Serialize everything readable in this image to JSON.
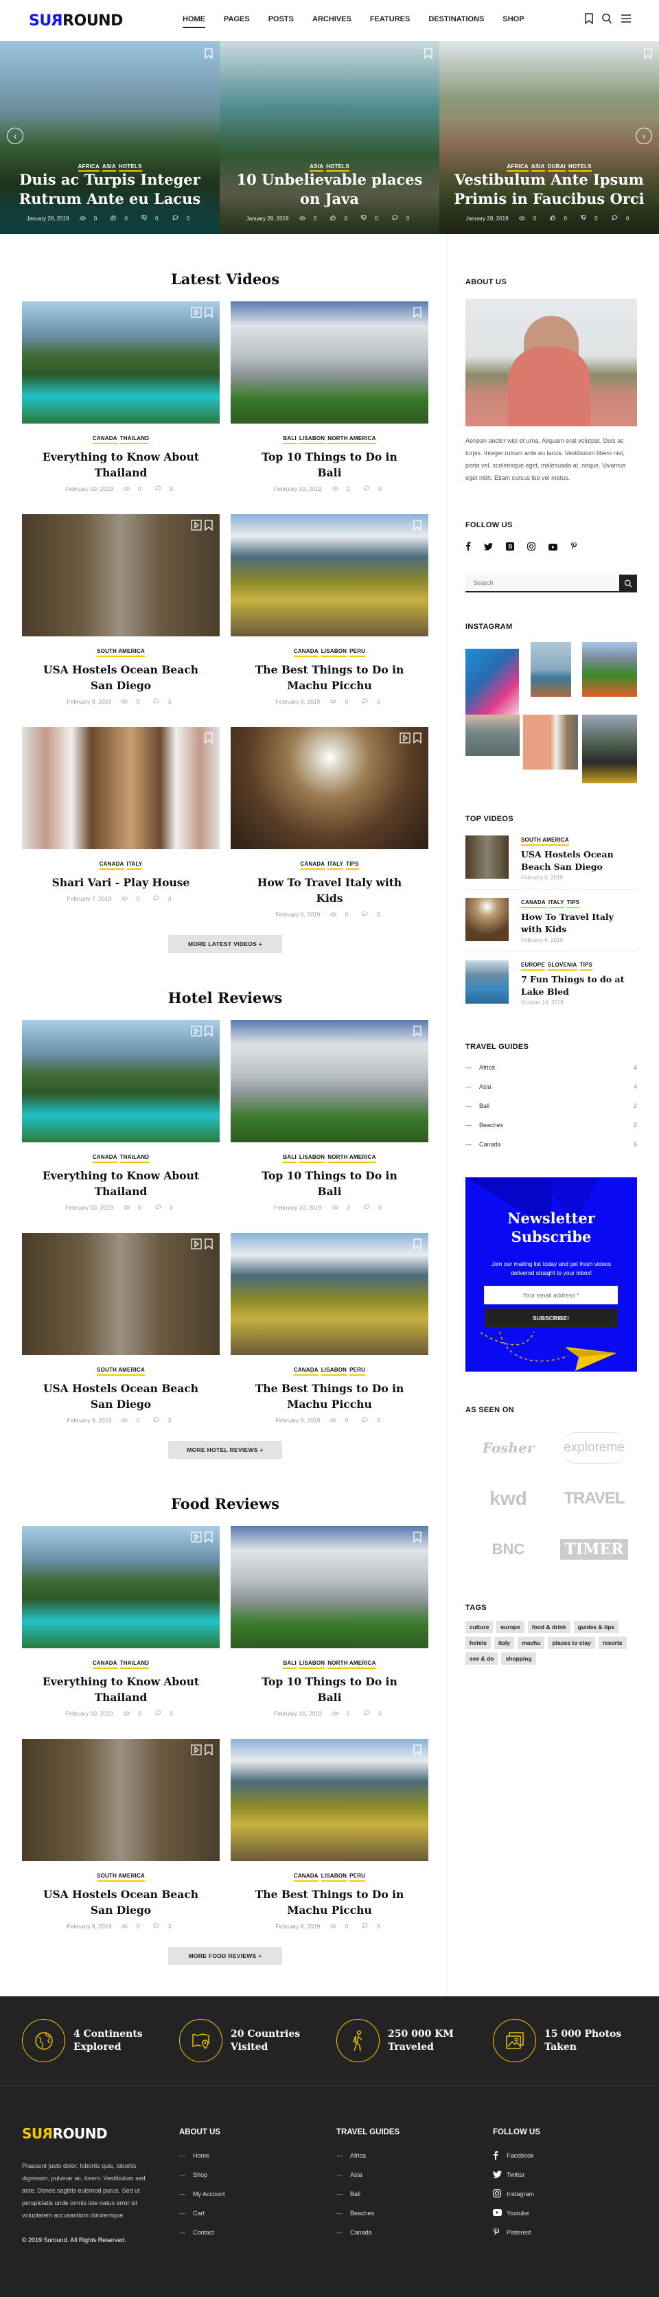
{
  "header": {
    "logo": {
      "part1": "SU",
      "mirrored": "R",
      "part2": "ROUND"
    },
    "nav": [
      {
        "label": "HOME",
        "active": true
      },
      {
        "label": "PAGES"
      },
      {
        "label": "POSTS"
      },
      {
        "label": "ARCHIVES"
      },
      {
        "label": "FEATURES"
      },
      {
        "label": "DESTINATIONS"
      },
      {
        "label": "SHOP"
      }
    ],
    "icons": [
      "bookmark-icon",
      "search-icon",
      "menu-icon"
    ]
  },
  "hero": {
    "slides": [
      {
        "categories": [
          "AFRICA",
          "ASIA",
          "HOTELS"
        ],
        "title": "Duis ac Turpis Integer Rutrum Ante eu Lacus",
        "date": "January 28, 2019",
        "views": "0",
        "likes": "0",
        "dislikes": "0",
        "comments": "0",
        "bg": "linear-gradient(180deg,#9ec3e0 0%,#6c8fa0 35%,#3f6b3a 55%,#2a4a2c 75%,#1c8a8c 100%)"
      },
      {
        "categories": [
          "ASIA",
          "HOTELS"
        ],
        "title": "10 Unbelievable places on Java",
        "date": "January 28, 2019",
        "views": "0",
        "likes": "0",
        "dislikes": "0",
        "comments": "0",
        "bg": "linear-gradient(180deg,#c9dbe0 0%,#4e8a8c 35%,#3d6a3c 60%,#8a8a70 80%,#4f6b32 100%)"
      },
      {
        "categories": [
          "AFRICA",
          "ASIA",
          "DUBAI",
          "HOTELS"
        ],
        "title": "Vestibulum Ante Ipsum Primis in Faucibus Orci",
        "date": "January 28, 2019",
        "views": "0",
        "likes": "0",
        "dislikes": "0",
        "comments": "0",
        "bg": "linear-gradient(180deg,#dfe6e8 0%,#8a9a7a 30%,#9c7a5c 55%,#5a6a3a 80%,#3a4a2a 100%)"
      }
    ],
    "prev_icon": "chevron-left-icon",
    "next_icon": "chevron-right-icon"
  },
  "sections": [
    {
      "title": "Latest Videos",
      "more_label": "MORE LATEST VIDEOS",
      "posts": [
        {
          "categories": [
            "CANADA",
            "THAILAND"
          ],
          "title": "Everything to Know About Thailand",
          "date": "February 10, 2019",
          "views": "0",
          "comments": "0",
          "video": true,
          "bg": "linear-gradient(180deg,#a8cde8 0%,#6a8fa8 28%,#3e6b34 45%,#2d5a2a 60%,#22c2c8 78%,#2c7a3a 100%)"
        },
        {
          "categories": [
            "BALI",
            "LISABON",
            "NORTH AMERICA"
          ],
          "title": "Top 10 Things to Do in Bali",
          "date": "February 10, 2019",
          "views": "2",
          "comments": "0",
          "video": false,
          "bg": "linear-gradient(180deg,#5a7ab0 0%,#dfe3e6 20%,#b9c0c4 45%,#8e9698 60%,#3a7a2a 80%,#2e5a22 100%)"
        },
        {
          "categories": [
            "SOUTH AMERICA"
          ],
          "title": "USA Hostels Ocean Beach San Diego",
          "date": "February 9, 2019",
          "views": "0",
          "comments": "3",
          "video": true,
          "bg": "linear-gradient(90deg,#4a3c28 0%,#6a5a40 30%,#9a9080 50%,#6a5a42 70%,#4a3e2a 100%)"
        },
        {
          "categories": [
            "CANADA",
            "LISABON",
            "PERU"
          ],
          "title": "The Best Things to Do in Machu Picchu",
          "date": "February 8, 2019",
          "views": "0",
          "comments": "3",
          "video": false,
          "bg": "linear-gradient(180deg,#8ab0d8 0%,#e8ecef 18%,#4c6a7a 35%,#8a8a2a 55%,#c8b040 70%,#6a5a3a 100%)"
        },
        {
          "categories": [
            "CANADA",
            "ITALY"
          ],
          "title": "Shari Vari - Play House",
          "date": "February 7, 2019",
          "views": "0",
          "comments": "3",
          "video": false,
          "bg": "linear-gradient(90deg,#e0e0e0 0%,#c49a88 12%,#f0f0f0 25%,#6a4a30 35%,#c8a070 55%,#6a4a30 70%,#f0f0f0 78%,#c49a88 90%,#e0e0e0 100%)"
        },
        {
          "categories": [
            "CANADA",
            "ITALY",
            "TIPS"
          ],
          "title": "How To Travel Italy with Kids",
          "date": "February 6, 2019",
          "views": "0",
          "comments": "3",
          "video": true,
          "bg": "radial-gradient(circle at 50% 25%,#ffffff 0%,#d8d0c0 10%,#9a7a50 30%,#5a3e26 60%,#2a1e14 100%)"
        }
      ]
    },
    {
      "title": "Hotel Reviews",
      "more_label": "MORE HOTEL REVIEWS",
      "posts": [
        {
          "categories": [
            "CANADA",
            "THAILAND"
          ],
          "title": "Everything to Know About Thailand",
          "date": "February 10, 2019",
          "views": "0",
          "comments": "0",
          "video": true,
          "bg": "linear-gradient(180deg,#a8cde8 0%,#6a8fa8 28%,#3e6b34 45%,#2d5a2a 60%,#22c2c8 78%,#2c7a3a 100%)"
        },
        {
          "categories": [
            "BALI",
            "LISABON",
            "NORTH AMERICA"
          ],
          "title": "Top 10 Things to Do in Bali",
          "date": "February 10, 2019",
          "views": "2",
          "comments": "0",
          "video": false,
          "bg": "linear-gradient(180deg,#5a7ab0 0%,#dfe3e6 20%,#b9c0c4 45%,#8e9698 60%,#3a7a2a 80%,#2e5a22 100%)"
        },
        {
          "categories": [
            "SOUTH AMERICA"
          ],
          "title": "USA Hostels Ocean Beach San Diego",
          "date": "February 9, 2019",
          "views": "0",
          "comments": "3",
          "video": true,
          "bg": "linear-gradient(90deg,#4a3c28 0%,#6a5a40 30%,#9a9080 50%,#6a5a42 70%,#4a3e2a 100%)"
        },
        {
          "categories": [
            "CANADA",
            "LISABON",
            "PERU"
          ],
          "title": "The Best Things to Do in Machu Picchu",
          "date": "February 8, 2019",
          "views": "0",
          "comments": "3",
          "video": false,
          "bg": "linear-gradient(180deg,#8ab0d8 0%,#e8ecef 18%,#4c6a7a 35%,#8a8a2a 55%,#c8b040 70%,#6a5a3a 100%)"
        }
      ]
    },
    {
      "title": "Food Reviews",
      "more_label": "MORE FOOD REVIEWS",
      "posts": [
        {
          "categories": [
            "CANADA",
            "THAILAND"
          ],
          "title": "Everything to Know About Thailand",
          "date": "February 10, 2019",
          "views": "0",
          "comments": "0",
          "video": true,
          "bg": "linear-gradient(180deg,#a8cde8 0%,#6a8fa8 28%,#3e6b34 45%,#2d5a2a 60%,#22c2c8 78%,#2c7a3a 100%)"
        },
        {
          "categories": [
            "BALI",
            "LISABON",
            "NORTH AMERICA"
          ],
          "title": "Top 10 Things to Do in Bali",
          "date": "February 10, 2019",
          "views": "2",
          "comments": "0",
          "video": false,
          "bg": "linear-gradient(180deg,#5a7ab0 0%,#dfe3e6 20%,#b9c0c4 45%,#8e9698 60%,#3a7a2a 80%,#2e5a22 100%)"
        },
        {
          "categories": [
            "SOUTH AMERICA"
          ],
          "title": "USA Hostels Ocean Beach San Diego",
          "date": "February 9, 2019",
          "views": "0",
          "comments": "3",
          "video": true,
          "bg": "linear-gradient(90deg,#4a3c28 0%,#6a5a40 30%,#9a9080 50%,#6a5a42 70%,#4a3e2a 100%)"
        },
        {
          "categories": [
            "CANADA",
            "LISABON",
            "PERU"
          ],
          "title": "The Best Things to Do in Machu Picchu",
          "date": "February 8, 2019",
          "views": "0",
          "comments": "3",
          "video": false,
          "bg": "linear-gradient(180deg,#8ab0d8 0%,#e8ecef 18%,#4c6a7a 35%,#8a8a2a 55%,#c8b040 70%,#6a5a3a 100%)"
        }
      ]
    }
  ],
  "sidebar": {
    "about": {
      "title": "ABOUT US",
      "text": "Aenean auctor wisi et urna. Aliquam erat volutpat. Duis ac turpis. Integer rutrum ante eu lacus. Vestibulum libero nisl, porta vel, scelerisque eget, malesuada at, neque. Vivamus eget nibh. Etiam cursus leo vel metus."
    },
    "follow": {
      "title": "FOLLOW US",
      "icons": [
        "facebook-icon",
        "twitter-icon",
        "bloglovin-icon",
        "instagram-icon",
        "youtube-icon",
        "pinterest-icon"
      ]
    },
    "search": {
      "placeholder": "Search"
    },
    "instagram": {
      "title": "INSTAGRAM"
    },
    "top_videos": {
      "title": "TOP VIDEOS",
      "items": [
        {
          "categories": [
            "SOUTH AMERICA"
          ],
          "title": "USA Hostels Ocean Beach San Diego",
          "date": "February 9, 2019",
          "bg": "linear-gradient(90deg,#4a3c28,#8a8070,#4a3e2a)"
        },
        {
          "categories": [
            "CANADA",
            "ITALY",
            "TIPS"
          ],
          "title": "How To Travel Italy with Kids",
          "date": "February 6, 2019",
          "bg": "radial-gradient(circle at 50% 20%,#fff 0%,#b89a70 25%,#5a3e26 70%)"
        },
        {
          "categories": [
            "EUROPE",
            "SLOVENIA",
            "TIPS"
          ],
          "title": "7 Fun Things to do at Lake Bled",
          "date": "October 14, 2018",
          "bg": "linear-gradient(180deg,#c8dcea 0%,#6a8aa0 35%,#3a8ac0 65%,#2a6a9a 100%)"
        }
      ]
    },
    "travel_guides": {
      "title": "TRAVEL GUIDES",
      "items": [
        {
          "name": "Africa",
          "count": "4"
        },
        {
          "name": "Asia",
          "count": "4"
        },
        {
          "name": "Bali",
          "count": "2"
        },
        {
          "name": "Beaches",
          "count": "2"
        },
        {
          "name": "Canada",
          "count": "6"
        }
      ]
    },
    "newsletter": {
      "title": "Newsletter Subscribe",
      "text": "Join our mailing list today and get fresh videos delivered straight to your inbox!",
      "placeholder": "Your email address *",
      "button": "SUBSCRIBE!",
      "bg_color": "#0a0af2"
    },
    "as_seen_on": {
      "title": "AS SEEN ON",
      "logos": [
        "Fosher",
        "exploreme",
        "kwd",
        "TRAVEL",
        "BNC",
        "TIMER"
      ]
    },
    "tags": {
      "title": "TAGS",
      "items": [
        "culture",
        "europe",
        "food & drink",
        "guides & tips",
        "hotels",
        "italy",
        "machu",
        "places to stay",
        "resorts",
        "see & do",
        "shopping"
      ]
    }
  },
  "footer": {
    "stats": [
      {
        "icon": "globe-icon",
        "line1": "4 Continents",
        "line2": "Explored"
      },
      {
        "icon": "map-pin-icon",
        "line1": "20 Countries",
        "line2": "Visited"
      },
      {
        "icon": "hiker-icon",
        "line1": "250 000 KM",
        "line2": "Traveled"
      },
      {
        "icon": "photo-icon",
        "line1": "15 000 Photos",
        "line2": "Taken"
      }
    ],
    "logo": {
      "part1": "SU",
      "mirrored": "R",
      "part2": "ROUND"
    },
    "text": "Praesent justo dolor, lobortis quis, lobortis dignissim, pulvinar ac, lorem. Vestibulum sed ante. Donec sagittis euismod purus. Sed ut perspiciatis unde omnis iste natus error sit voluptatem accusantium doloremque.",
    "copyright": "© 2019 Suround. All Rights Reserved.",
    "about": {
      "title": "ABOUT US",
      "links": [
        "Home",
        "Shop",
        "My Account",
        "Cart",
        "Contact"
      ]
    },
    "guides": {
      "title": "TRAVEL GUIDES",
      "links": [
        "Africa",
        "Asia",
        "Bali",
        "Beaches",
        "Canada"
      ]
    },
    "follow": {
      "title": "FOLLOW US",
      "links": [
        {
          "label": "Facebook",
          "icon": "facebook-icon"
        },
        {
          "label": "Twitter",
          "icon": "twitter-icon"
        },
        {
          "label": "Instagram",
          "icon": "instagram-icon"
        },
        {
          "label": "Youtube",
          "icon": "youtube-icon"
        },
        {
          "label": "Pinterest",
          "icon": "pinterest-icon"
        }
      ]
    }
  },
  "colors": {
    "brand_blue": "#1414f0",
    "accent_yellow": "#f5c800",
    "footer_bg": "#232323"
  }
}
